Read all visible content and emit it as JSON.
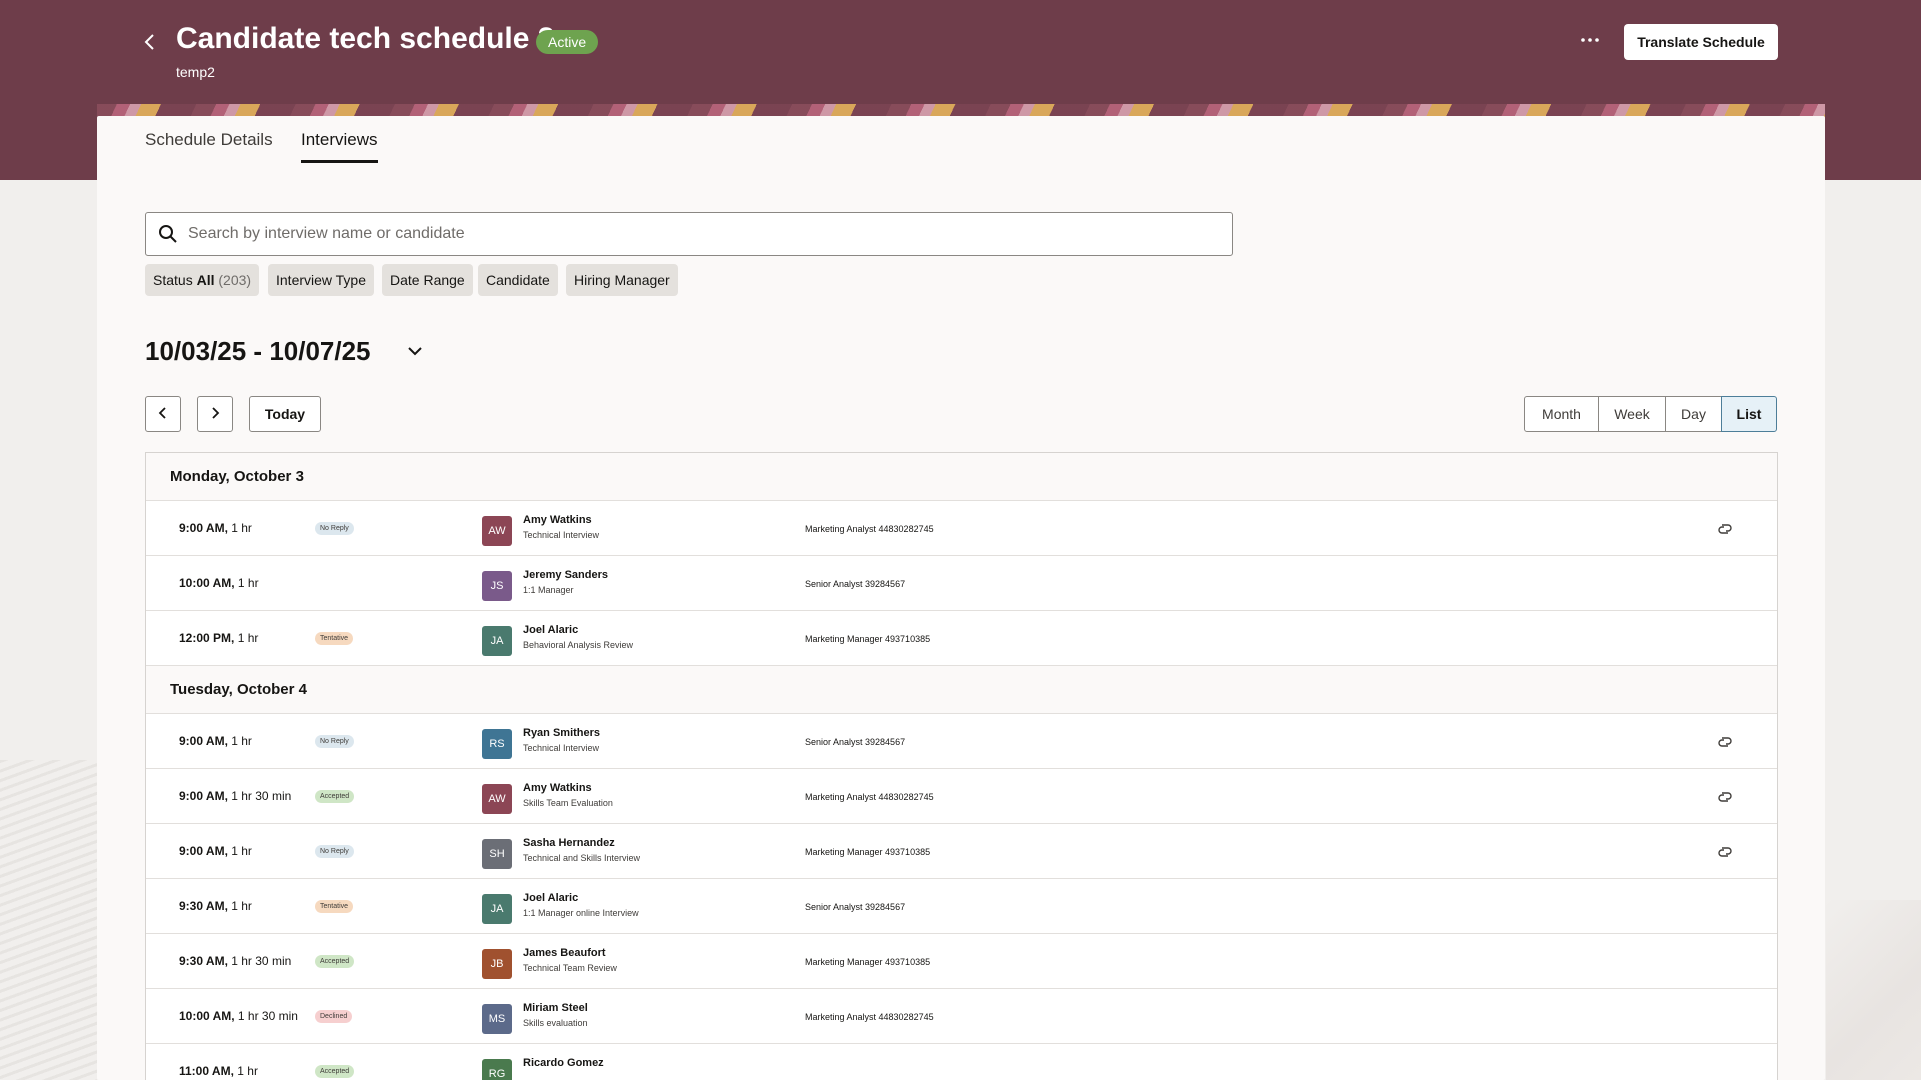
{
  "header": {
    "title": "Candidate tech schedule 2",
    "status": "Active",
    "subtitle": "temp2",
    "translate_label": "Translate Schedule"
  },
  "tabs": [
    {
      "label": "Schedule Details",
      "active": false
    },
    {
      "label": "Interviews",
      "active": true
    }
  ],
  "search": {
    "placeholder": "Search by interview name or candidate",
    "value": ""
  },
  "filters": {
    "status": {
      "label": "Status",
      "value": "All",
      "count": "(203)"
    },
    "interview_type": "Interview Type",
    "date_range": "Date Range",
    "candidate": "Candidate",
    "hiring_manager": "Hiring Manager"
  },
  "date_range": "10/03/25 - 10/07/25",
  "toolbar": {
    "today_label": "Today",
    "views": [
      "Month",
      "Week",
      "Day",
      "List"
    ],
    "active_view": "List"
  },
  "colors": {
    "header_bg": "#6e3d4a",
    "active_badge": "#6ea34f",
    "no_reply": "#dce7ee",
    "tentative": "#f6d9bf",
    "accepted": "#cfe6c6",
    "declined": "#f6cfcf"
  },
  "days": [
    {
      "label": "Monday, October 3",
      "rows": [
        {
          "time": "9:00 AM,",
          "duration": "1 hr",
          "status": "No Reply",
          "status_color": "#dce7ee",
          "initials": "AW",
          "avatar_color": "#8c4655",
          "name": "Amy Watkins",
          "type": "Technical Interview",
          "job": "Marketing Analyst 44830282745",
          "link": true
        },
        {
          "time": "10:00 AM,",
          "duration": "1 hr",
          "status": "",
          "status_color": "",
          "initials": "JS",
          "avatar_color": "#7a5a8a",
          "name": "Jeremy Sanders",
          "type": "1:1 Manager",
          "job": "Senior Analyst 39284567",
          "link": false
        },
        {
          "time": "12:00 PM,",
          "duration": "1 hr",
          "status": "Tentative",
          "status_color": "#f6d9bf",
          "initials": "JA",
          "avatar_color": "#4a7a6e",
          "name": "Joel Alaric",
          "type": "Behavioral Analysis Review",
          "job": "Marketing Manager 493710385",
          "link": false
        }
      ]
    },
    {
      "label": "Tuesday, October 4",
      "rows": [
        {
          "time": "9:00 AM,",
          "duration": "1 hr",
          "status": "No Reply",
          "status_color": "#dce7ee",
          "initials": "RS",
          "avatar_color": "#3f7594",
          "name": "Ryan Smithers",
          "type": "Technical Interview",
          "job": "Senior Analyst 39284567",
          "link": true
        },
        {
          "time": "9:00 AM,",
          "duration": "1 hr 30 min",
          "status": "Accepted",
          "status_color": "#cfe6c6",
          "initials": "AW",
          "avatar_color": "#8c4655",
          "name": "Amy Watkins",
          "type": "Skills Team Evaluation",
          "job": "Marketing Analyst 44830282745",
          "link": true
        },
        {
          "time": "9:00 AM,",
          "duration": "1 hr",
          "status": "No Reply",
          "status_color": "#dce7ee",
          "initials": "SH",
          "avatar_color": "#6b6e76",
          "name": "Sasha Hernandez",
          "type": "Technical and Skills Interview",
          "job": "Marketing Manager 493710385",
          "link": true
        },
        {
          "time": "9:30 AM,",
          "duration": "1 hr",
          "status": "Tentative",
          "status_color": "#f6d9bf",
          "initials": "JA",
          "avatar_color": "#4a7a6e",
          "name": "Joel Alaric",
          "type": "1:1 Manager online Interview",
          "job": "Senior Analyst 39284567",
          "link": false
        },
        {
          "time": "9:30 AM,",
          "duration": "1 hr 30 min",
          "status": "Accepted",
          "status_color": "#cfe6c6",
          "initials": "JB",
          "avatar_color": "#a0512f",
          "name": "James Beaufort",
          "type": "Technical Team Review",
          "job": "Marketing Manager 493710385",
          "link": false
        },
        {
          "time": "10:00 AM,",
          "duration": "1 hr 30 min",
          "status": "Declined",
          "status_color": "#f6cfcf",
          "initials": "MS",
          "avatar_color": "#5c6a8a",
          "name": "Miriam Steel",
          "type": "Skills evaluation",
          "job": "Marketing Analyst 44830282745",
          "link": false
        },
        {
          "time": "11:00 AM,",
          "duration": "1 hr",
          "status": "Accepted",
          "status_color": "#cfe6c6",
          "initials": "RG",
          "avatar_color": "#4a7a4e",
          "name": "Ricardo Gomez",
          "type": "",
          "job": "",
          "link": false
        }
      ]
    }
  ]
}
